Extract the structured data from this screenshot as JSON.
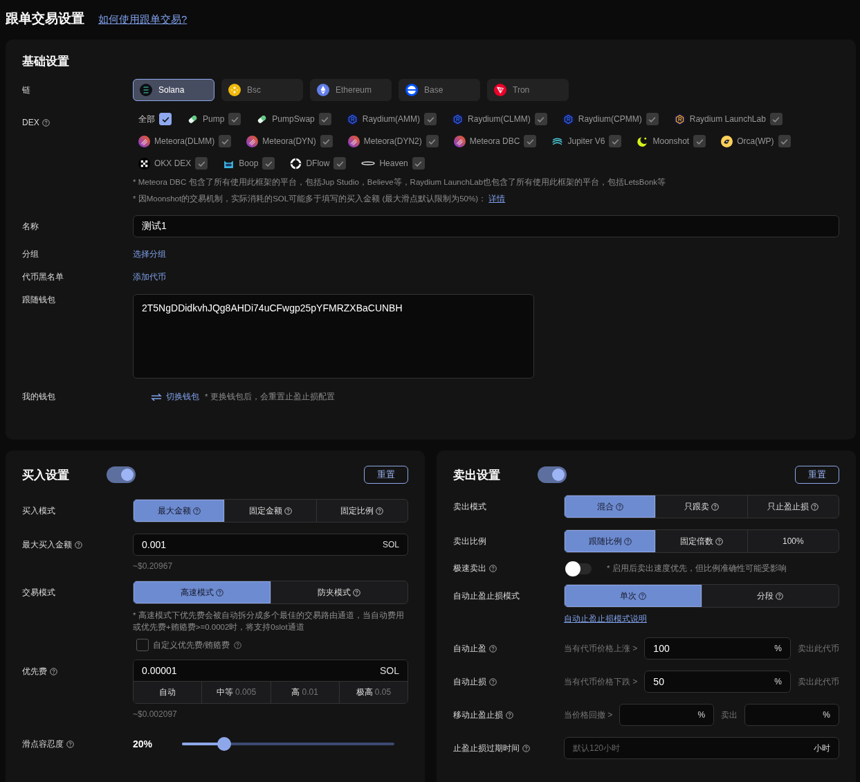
{
  "header": {
    "title": "跟单交易设置",
    "help_link": "如何使用跟单交易?"
  },
  "basic": {
    "title": "基础设置",
    "chain": {
      "label": "链",
      "options": [
        {
          "label": "Solana",
          "selected": true
        },
        {
          "label": "Bsc",
          "selected": false
        },
        {
          "label": "Ethereum",
          "selected": false
        },
        {
          "label": "Base",
          "selected": false
        },
        {
          "label": "Tron",
          "selected": false
        }
      ]
    },
    "dex": {
      "label": "DEX",
      "help": true,
      "all": {
        "label": "全部",
        "checked": true
      },
      "items": [
        {
          "label": "Pump",
          "checked": true,
          "disabled": true
        },
        {
          "label": "PumpSwap",
          "checked": true,
          "disabled": true
        },
        {
          "label": "Raydium(AMM)",
          "checked": true,
          "disabled": true
        },
        {
          "label": "Raydium(CLMM)",
          "checked": true,
          "disabled": true
        },
        {
          "label": "Raydium(CPMM)",
          "checked": true,
          "disabled": true
        },
        {
          "label": "Raydium LaunchLab",
          "checked": true,
          "disabled": true
        },
        {
          "label": "Meteora(DLMM)",
          "checked": true,
          "disabled": true
        },
        {
          "label": "Meteora(DYN)",
          "checked": true,
          "disabled": true
        },
        {
          "label": "Meteora(DYN2)",
          "checked": true,
          "disabled": true
        },
        {
          "label": "Meteora DBC",
          "checked": true,
          "disabled": true
        },
        {
          "label": "Jupiter V6",
          "checked": true,
          "disabled": true
        },
        {
          "label": "Moonshot",
          "checked": true,
          "disabled": true
        },
        {
          "label": "Orca(WP)",
          "checked": true,
          "disabled": true
        },
        {
          "label": "OKX DEX",
          "checked": true,
          "disabled": true
        },
        {
          "label": "Boop",
          "checked": true,
          "disabled": true
        },
        {
          "label": "DFlow",
          "checked": true,
          "disabled": true
        },
        {
          "label": "Heaven",
          "checked": true,
          "disabled": true
        }
      ],
      "notes": [
        "* Meteora DBC 包含了所有使用此框架的平台，包括Jup Studio，Believe等，Raydium LaunchLab也包含了所有使用此框架的平台，包括LetsBonk等",
        "* 因Moonshot的交易机制，实际消耗的SOL可能多于填写的买入金额 (最大滑点默认限制为50%)："
      ],
      "note_link": "详情"
    },
    "name": {
      "label": "名称",
      "value": "测试1"
    },
    "group": {
      "label": "分组",
      "link": "选择分组"
    },
    "blacklist": {
      "label": "代币黑名单",
      "link": "添加代币"
    },
    "follow_wallet": {
      "label": "跟随钱包",
      "value": "2T5NgDDidkvhJQg8AHDi74uCFwgp25pYFMRZXBaCUNBH"
    },
    "my_wallet": {
      "label": "我的钱包",
      "link": "切换钱包",
      "note": "* 更换钱包后，会重置止盈止损配置"
    }
  },
  "buy": {
    "title": "买入设置",
    "on": true,
    "reset": "重置",
    "mode": {
      "label": "买入模式",
      "options": [
        {
          "label": "最大金额",
          "selected": true,
          "help": true
        },
        {
          "label": "固定金额",
          "selected": false,
          "help": true
        },
        {
          "label": "固定比例",
          "selected": false,
          "help": true
        }
      ]
    },
    "max_amount": {
      "label": "最大买入金额",
      "help": true,
      "value": "0.001",
      "unit": "SOL",
      "usd": "~$0.20967"
    },
    "trade_mode": {
      "label": "交易模式",
      "options": [
        {
          "label": "高速模式",
          "selected": true,
          "help": true
        },
        {
          "label": "防夹模式",
          "selected": false,
          "help": true
        }
      ],
      "note": "* 高速模式下优先费会被自动拆分成多个最佳的交易路由通道，当自动费用或优先费+贿赂费>=0.0002时，将支持0slot通道"
    },
    "custom_fee": {
      "label": "自定义优先费/贿赂费",
      "help": true,
      "checked": false
    },
    "priority_fee": {
      "label": "优先费",
      "help": true,
      "value": "0.00001",
      "unit": "SOL",
      "presets": [
        {
          "label": "自动"
        },
        {
          "label": "中等",
          "value": "0.005"
        },
        {
          "label": "高",
          "value": "0.01"
        },
        {
          "label": "极高",
          "value": "0.05"
        }
      ],
      "usd": "~$0.002097"
    },
    "slippage": {
      "label": "滑点容忍度",
      "help": true,
      "reading": "20%",
      "level": 0.2
    }
  },
  "sell": {
    "title": "卖出设置",
    "on": true,
    "reset": "重置",
    "mode": {
      "label": "卖出模式",
      "options": [
        {
          "label": "混合",
          "selected": true,
          "help": true
        },
        {
          "label": "只跟卖",
          "selected": false,
          "help": true
        },
        {
          "label": "只止盈止损",
          "selected": false,
          "help": true
        }
      ]
    },
    "ratio": {
      "label": "卖出比例",
      "options": [
        {
          "label": "跟随比例",
          "selected": true,
          "help": true
        },
        {
          "label": "固定倍数",
          "selected": false,
          "help": true
        },
        {
          "label": "100%",
          "selected": false,
          "help": false
        }
      ]
    },
    "fast_sell": {
      "label": "极速卖出",
      "help": true,
      "on": false,
      "note": "* 启用后卖出速度优先，但比例准确性可能受影响"
    },
    "tpsl_mode": {
      "label": "自动止盈止损模式",
      "options": [
        {
          "label": "单次",
          "selected": true,
          "help": true
        },
        {
          "label": "分段",
          "selected": false,
          "help": true
        }
      ],
      "link": "自动止盈止损模式说明"
    },
    "take_profit": {
      "label": "自动止盈",
      "help": true,
      "prefix": "当有代币价格上涨 >",
      "value": "100",
      "unit": "%",
      "suffix": "卖出此代币"
    },
    "stop_loss": {
      "label": "自动止损",
      "help": true,
      "prefix": "当有代币价格下跌 >",
      "value": "50",
      "unit": "%",
      "suffix": "卖出此代币"
    },
    "trailing": {
      "label": "移动止盈止损",
      "help": true,
      "prefix": "当价格回撤 >",
      "unit": "%",
      "middle": "卖出",
      "unit2": "%"
    },
    "expiry": {
      "label": "止盈止损过期时间",
      "help": true,
      "placeholder": "默认120小时",
      "unit": "小时"
    }
  }
}
